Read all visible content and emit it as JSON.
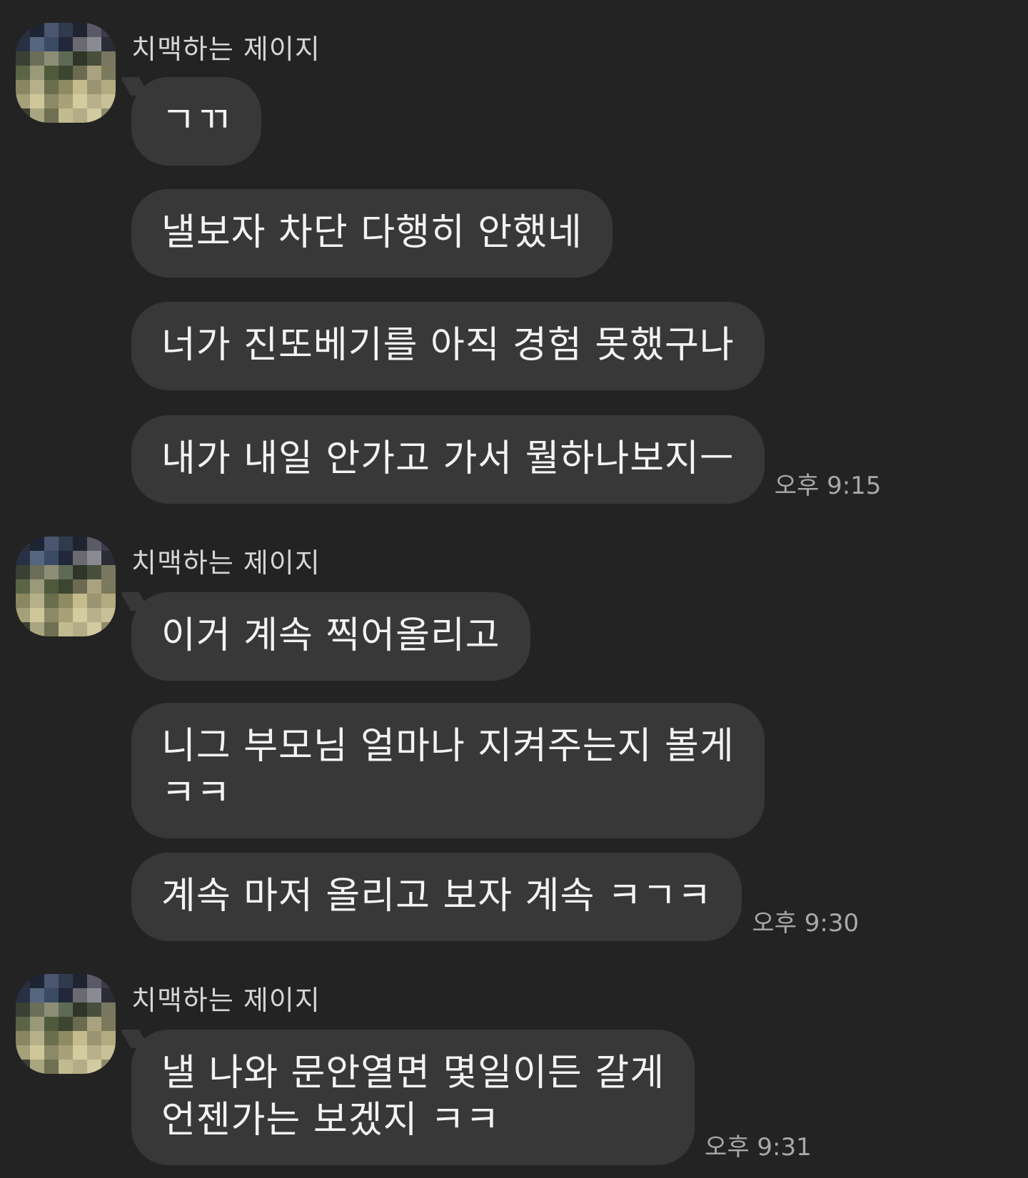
{
  "colors": {
    "background": "#232323",
    "bubble": "#383838",
    "text": "#f3f3f3",
    "timestamp": "#a9a9a9"
  },
  "groups": [
    {
      "sender": "치맥하는 제이지",
      "messages": [
        {
          "text": "ㄱㄲ"
        },
        {
          "text": "낼보자 차단 다행히 안했네"
        },
        {
          "text": "너가 진또베기를 아직 경험 못했구나"
        },
        {
          "text": "내가 내일 안가고 가서 뭘하나보지ㅡ",
          "time": "오후 9:15"
        }
      ]
    },
    {
      "sender": "치맥하는 제이지",
      "messages": [
        {
          "text": "이거 계속 찍어올리고"
        },
        {
          "text": "니그 부모님 얼마나 지켜주는지 볼게\nㅋㅋ"
        },
        {
          "text": "계속 마저 올리고 보자 계속 ㅋㄱㅋ",
          "time": "오후 9:30"
        }
      ]
    },
    {
      "sender": "치맥하는 제이지",
      "messages": [
        {
          "text": "낼 나와 문안열면 몇일이든 갈게\n언젠가는 보겠지 ㅋㅋ",
          "time": "오후 9:31"
        }
      ]
    }
  ]
}
